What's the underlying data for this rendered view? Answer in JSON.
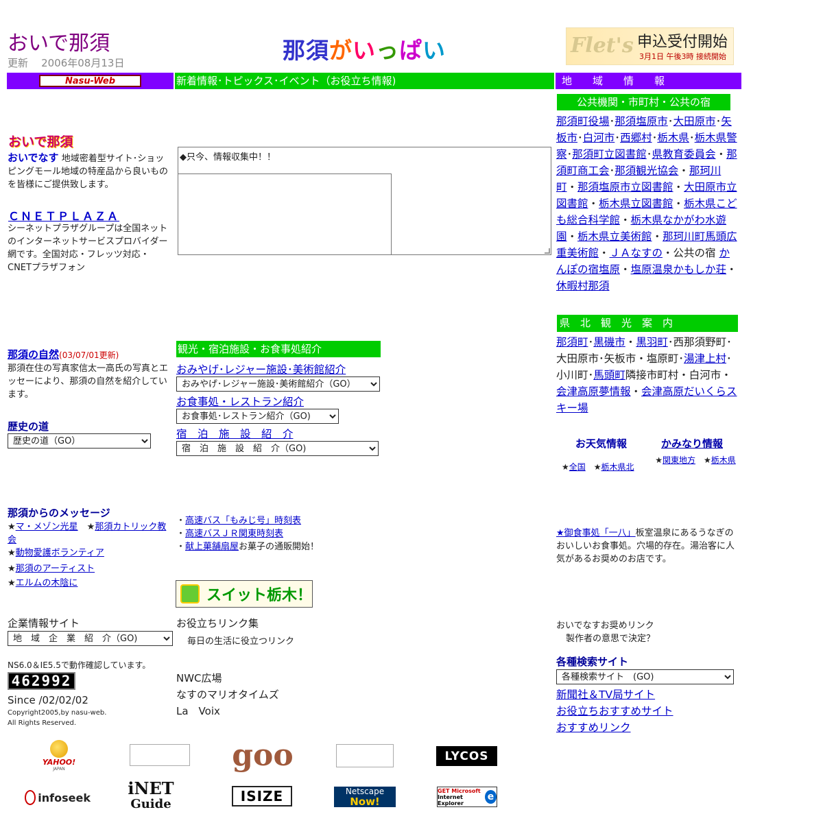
{
  "header": {
    "site_title": "おいで那須",
    "updated_label": "更新",
    "updated_date": "2006年08月13日",
    "center_logo": [
      "那",
      "須",
      "が",
      "い",
      "っ",
      "ぱ",
      "い"
    ],
    "banner_brand": "Flet's",
    "banner_title": "申込受付開始",
    "banner_sub": "3月1日 午後3時 接続開始"
  },
  "bars": {
    "left_logo": "Nasu-Web",
    "center": "新着情報･トピックス･イベント（お役立ち情報)",
    "right": "地　　域　　情　　報",
    "public": "公共機関・市町村・公共の宿",
    "kenpoku": "県　北　観　光　案　内",
    "tourism": "観光・宿泊施設・お食事処紹介"
  },
  "left": {
    "oide_logo": "おいで那須",
    "oide_title": "おいでなす",
    "oide_desc": " 地域密着型サイト･ショッピングモール地域の特産品から良いものを皆様にご提供致します。",
    "cnet_title": "ＣＮＥＴＰＬＡＺＡ",
    "cnet_desc": "シーネットプラザグループは全国ネットのインターネットサービスプロバイダー網です。全国対応・フレッツ対応・CNETプラザフォン",
    "nature_title": "那須の自然",
    "nature_updated": "(03/07/01更新)",
    "nature_desc": "那須在住の写真家信太一高氏の写真とエッセーにより、那須の自然を紹介しています。",
    "history_title": "歴史の道",
    "history_select": "歴史の道（GO）",
    "message_title": "那須からのメッセージ",
    "msg1": "マ・メゾン光星",
    "msg2": "那須カトリック教会",
    "msg3": "動物愛護ボランティア",
    "msg4": "那須のアーティスト",
    "msg5": "エルムの木陰に",
    "company_title": "企業情報サイト",
    "company_select": "地　域　企　業　紹　介（GO)",
    "browser_note": "NS6.0＆IE5.5で動作確認しています。",
    "counter": "462992",
    "since": "Since /02/02/02",
    "copyright1": "Copyright2005,by nasu-web.",
    "copyright2": "All Rights Reserved."
  },
  "center": {
    "notice": "◆只今、情報収集中！！",
    "souvenir_link": "おみやげ･レジャー施設･美術館紹介",
    "souvenir_select": "おみやげ･レジャー施設･美術館紹介（GO）",
    "dining_link": "お食事処・レストラン紹介",
    "dining_select": "お食事処･レストラン紹介（GO)",
    "lodging_link": "宿　泊　施　設　紹　介",
    "lodging_select": "宿　泊　施　設　紹　介（GO)",
    "bus1": "高速バス「もみじ号」時刻表",
    "bus2": "高速バスＪＲ関東時刻表",
    "sweets_link": "献上菓舗扇屋",
    "sweets_text": "お菓子の通販開始！",
    "suit_banner": "スイット栃木！",
    "useful_title": "お役立ちリンク集",
    "useful_sub": "毎日の生活に役立つリンク",
    "nwc": "NWC広場",
    "mario": "なすのマリオタイムズ",
    "voix": "La　Voix"
  },
  "right": {
    "public_links": [
      {
        "t": "那須町役場",
        "l": true
      },
      {
        "t": "･",
        "l": false
      },
      {
        "t": "那須塩原市",
        "l": true
      },
      {
        "t": "･",
        "l": false
      },
      {
        "t": "大田原市",
        "l": true
      },
      {
        "t": "･",
        "l": false
      },
      {
        "t": "矢板市",
        "l": true
      },
      {
        "t": "･",
        "l": false
      },
      {
        "t": "白河市",
        "l": true
      },
      {
        "t": "･",
        "l": false
      },
      {
        "t": "西郷村",
        "l": true
      },
      {
        "t": "･",
        "l": false
      },
      {
        "t": "栃木県",
        "l": true
      },
      {
        "t": "･",
        "l": false
      },
      {
        "t": "栃木県警察",
        "l": true
      },
      {
        "t": "･",
        "l": false
      },
      {
        "t": "那須町立図書館",
        "l": true
      },
      {
        "t": "･",
        "l": false
      },
      {
        "t": "県教育委員会",
        "l": true
      },
      {
        "t": "・",
        "l": false
      },
      {
        "t": "那須町商工会",
        "l": true
      },
      {
        "t": "･",
        "l": false
      },
      {
        "t": "那須観光協会",
        "l": true
      },
      {
        "t": "・",
        "l": false
      },
      {
        "t": "那珂川町",
        "l": true
      },
      {
        "t": "・",
        "l": false
      },
      {
        "t": "那須塩原市立図書館",
        "l": true
      },
      {
        "t": "・",
        "l": false
      },
      {
        "t": "大田原市立図書館",
        "l": true
      },
      {
        "t": "・",
        "l": false
      },
      {
        "t": "栃木県立図書館",
        "l": true
      },
      {
        "t": "・",
        "l": false
      },
      {
        "t": "栃木県こども総合科学館",
        "l": true
      },
      {
        "t": "・",
        "l": false
      },
      {
        "t": "栃木県なかがわ水遊園",
        "l": true
      },
      {
        "t": "・",
        "l": false
      },
      {
        "t": "栃木県立美術館",
        "l": true
      },
      {
        "t": "・",
        "l": false
      },
      {
        "t": "那珂川町馬頭広重美術館",
        "l": true
      },
      {
        "t": "・",
        "l": false
      },
      {
        "t": "ＪＡなすの",
        "l": true
      },
      {
        "t": "・公共の宿 ",
        "l": false
      },
      {
        "t": "かんぽの宿塩原",
        "l": true
      },
      {
        "t": "・",
        "l": false
      },
      {
        "t": "塩原温泉かもしか荘",
        "l": true
      },
      {
        "t": "・",
        "l": false
      },
      {
        "t": "休暇村那須",
        "l": true
      }
    ],
    "kenpoku_links": [
      {
        "t": "那須町",
        "l": true
      },
      {
        "t": "･",
        "l": false
      },
      {
        "t": "黒磯市",
        "l": true
      },
      {
        "t": "・",
        "l": false
      },
      {
        "t": "黒羽町",
        "l": true
      },
      {
        "t": "･西那須野町･大田原市･矢板市・塩原町･",
        "l": false
      },
      {
        "t": "湯津上村",
        "l": true
      },
      {
        "t": "･小川町･",
        "l": false
      },
      {
        "t": "馬頭町",
        "l": true
      },
      {
        "t": "隣接市町村・白河市・",
        "l": false
      },
      {
        "t": "会津高原夢情報",
        "l": true
      },
      {
        "t": "・",
        "l": false
      },
      {
        "t": "会津高原だいくらスキー場",
        "l": true
      }
    ],
    "weather_title": "お天気情報",
    "thunder_title": "かみなり情報",
    "weather1": "全国",
    "weather2": "栃木県北",
    "thunder1": "関東地方",
    "thunder2": "栃木県",
    "restaurant_link": "★御食事処「一八」",
    "restaurant_desc": "板室温泉にあるうなぎのおいしいお食事処。穴場的存在。湯治客に人気があるお奨めのお店です。",
    "recommend1": "おいでなすお奨めリンク",
    "recommend2": "製作者の意思で決定？",
    "search_title": "各種検索サイト",
    "search_select": "各種検索サイト　(GO)",
    "news_link": "新聞社＆TV局サイト",
    "useful_link": "お役立ちおすすめサイト",
    "recommend_link": "おすすめリンク"
  },
  "logos": {
    "yahoo": "YAHOO!",
    "yahoo_sub": "JAPAN",
    "goo": "goo",
    "lycos": "LYCOS",
    "infoseek": "infoseek",
    "inet": "iNET",
    "inet_sub": "Guide",
    "isize": "ISIZE",
    "netscape": "Netscape",
    "netscape_sub": "Now!",
    "ie_get": "GET Microsoft",
    "ie": "Internet Explorer"
  },
  "colors": {
    "purple_bar": "#8000ff",
    "green_bar": "#00cc00",
    "link": "#0000cc",
    "title_purple": "#800080"
  }
}
